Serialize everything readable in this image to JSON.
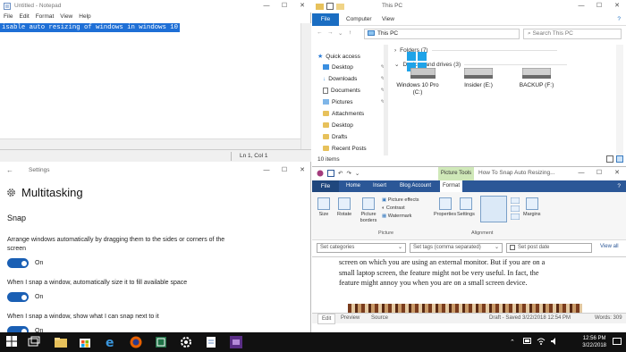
{
  "notepad": {
    "title": "Untitled - Notepad",
    "menu": [
      "File",
      "Edit",
      "Format",
      "View",
      "Help"
    ],
    "selected_text": "isable auto resizing of windows in windows 10",
    "status_position": "Ln 1, Col 1"
  },
  "settings": {
    "title": "Settings",
    "heading": "Multitasking",
    "section": "Snap",
    "options": [
      {
        "desc": "Arrange windows automatically by dragging them to the sides or corners of the screen",
        "state": "On"
      },
      {
        "desc": "When I snap a window, automatically size it to fill available space",
        "state": "On"
      },
      {
        "desc": "When I snap a window, show what I can snap next to it",
        "state": "On"
      }
    ]
  },
  "explorer": {
    "title": "This PC",
    "ribbon_tabs": [
      "File",
      "Computer",
      "View"
    ],
    "address": "This PC",
    "search_placeholder": "Search This PC",
    "nav": [
      {
        "label": "Quick access",
        "icon": "star-icon"
      },
      {
        "label": "Desktop",
        "icon": "desktop-icon"
      },
      {
        "label": "Downloads",
        "icon": "download-icon"
      },
      {
        "label": "Documents",
        "icon": "document-icon"
      },
      {
        "label": "Pictures",
        "icon": "picture-icon"
      },
      {
        "label": "Attachments",
        "icon": "folder-icon"
      },
      {
        "label": "Desktop",
        "icon": "folder-icon"
      },
      {
        "label": "Drafts",
        "icon": "folder-icon"
      },
      {
        "label": "Recent Posts",
        "icon": "folder-icon"
      }
    ],
    "groups": [
      "Folders (7)",
      "Devices and drives (3)"
    ],
    "drives": [
      {
        "name": "Windows 10 Pro",
        "letter": "(C:)"
      },
      {
        "name": "Insider (E:)",
        "letter": ""
      },
      {
        "name": "BACKUP (F:)",
        "letter": ""
      }
    ],
    "status": "10 items"
  },
  "word": {
    "picture_tools": "Picture Tools",
    "title": "How To Snap Auto Resizing...",
    "tabs": [
      "File",
      "Home",
      "Insert",
      "Blog Account",
      "Format"
    ],
    "ribbon": [
      {
        "label": "Size"
      },
      {
        "label": "Rotate"
      },
      {
        "label": "Picture borders"
      },
      {
        "label": "Picture effects"
      },
      {
        "label": "Contrast"
      },
      {
        "label": "Watermark"
      },
      {
        "label": "Properties"
      },
      {
        "label": "Settings"
      },
      {
        "label": "Margins"
      }
    ],
    "ribbon_groups": [
      "Picture",
      "Alignment"
    ],
    "fields": {
      "categories": "Set categories",
      "tags": "Set tags (comma separated)",
      "date": "Set post date",
      "view_all": "View all"
    },
    "body": [
      "screen on which you are using an external monitor. But if you are on a",
      "small laptop screen, the feature might not be very useful. In fact, the",
      "feature might annoy you when you are on a small screen device."
    ],
    "bottom_tabs": [
      "Edit",
      "Preview",
      "Source"
    ],
    "status": "Draft - Saved 3/22/2018 12:54 PM",
    "words": "Words: 309"
  },
  "taskbar": {
    "time": "12:56 PM",
    "date": "3/22/2018"
  }
}
